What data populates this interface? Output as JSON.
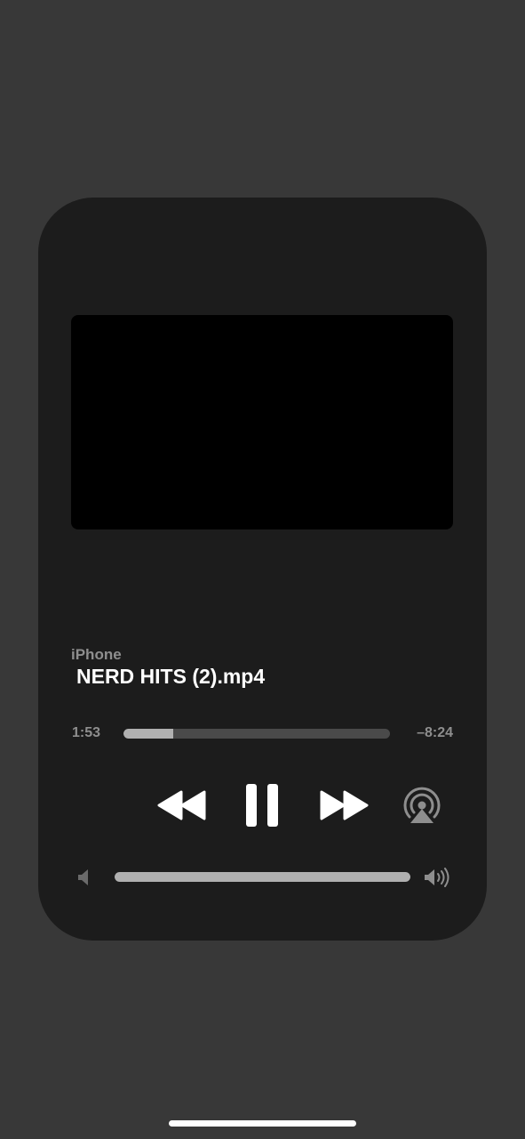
{
  "player": {
    "source": "iPhone",
    "title": "NERD HITS (2).mp4",
    "elapsed": "1:53",
    "remaining": "–8:24",
    "progress": 0.188,
    "volume": 1.0
  },
  "icons": {
    "rewind": "rewind-icon",
    "pause": "pause-icon",
    "forward": "fast-forward-icon",
    "airplay": "airplay-icon",
    "volume_low": "speaker-low-icon",
    "volume_high": "speaker-high-icon"
  },
  "colors": {
    "background": "#383838",
    "card": "#1c1c1c",
    "artwork": "#000000",
    "secondary_text": "#8e8e8e",
    "primary_text": "#ffffff",
    "track": "#4a4a4a",
    "track_fill": "#b0b0b0"
  }
}
